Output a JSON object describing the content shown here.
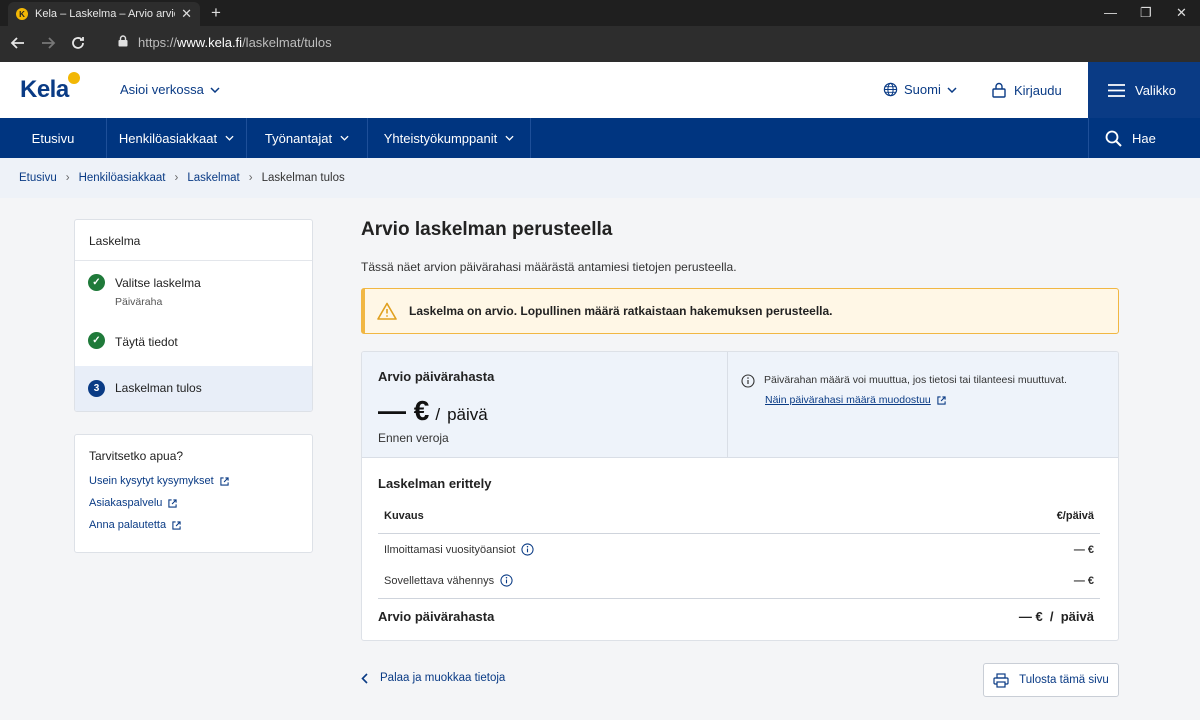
{
  "browser": {
    "tab_title": "Kela – Laskelma – Arvio arviom",
    "favicon_letter": "K",
    "url_prefix": "https://",
    "url_domain": "www.kela.fi",
    "url_path": "/laskelmat/tulos"
  },
  "header": {
    "logo": "Kela",
    "asioi": "Asioi verkossa",
    "language": "Suomi",
    "login": "Kirjaudu",
    "menu": "Valikko"
  },
  "nav": {
    "items": [
      "Etusivu",
      "Henkilöasiakkaat",
      "Työnantajat",
      "Yhteistyökumppanit"
    ],
    "search": "Hae"
  },
  "breadcrumb": {
    "items": [
      "Etusivu",
      "Henkilöasiakkaat",
      "Laskelmat"
    ],
    "current": "Laskelman tulos"
  },
  "steps": {
    "title": "Laskelma",
    "items": [
      {
        "label": "Valitse laskelma",
        "sub": "Päiväraha",
        "status": "done"
      },
      {
        "label": "Täytä tiedot",
        "status": "done"
      },
      {
        "label": "Laskelman tulos",
        "number": "3",
        "status": "current"
      }
    ]
  },
  "help": {
    "title": "Tarvitsetko apua?",
    "links": [
      "Usein kysytyt kysymykset",
      "Asiakaspalvelu",
      "Anna palautetta"
    ]
  },
  "main": {
    "title": "Arvio laskelman perusteella",
    "lead": "Tässä näet arvion päivärahasi määrästä antamiesi tietojen perusteella.",
    "notice": "Laskelma on arvio. Lopullinen määrä ratkaistaan hakemuksen perusteella."
  },
  "result": {
    "title": "Arvio päivärahasta",
    "amount": "— €",
    "slash": "/",
    "unit": "päivä",
    "tax_note": "Ennen veroja",
    "info": "Päivärahan määrä voi muuttua, jos tietosi tai tilanteesi muuttuvat.",
    "info_link": "Näin päivärahasi määrä muodostuu"
  },
  "breakdown": {
    "title": "Laskelman erittely",
    "col_desc": "Kuvaus",
    "col_value": "€/päivä",
    "rows": [
      {
        "label": "Ilmoittamasi vuosityöansiot",
        "value": "— €"
      },
      {
        "label": "Sovellettava vähennys",
        "value": "— €"
      }
    ],
    "total_label": "Arvio päivärahasta",
    "total_value": "— €  /  päivä"
  },
  "actions": {
    "back": "Palaa ja muokkaa tietoja",
    "print": "Tulosta tämä sivu"
  },
  "colors": {
    "brand_blue": "#003580",
    "accent_yellow": "#f2b705",
    "success_green": "#1f7a3a",
    "warning_border": "#f1b743"
  }
}
